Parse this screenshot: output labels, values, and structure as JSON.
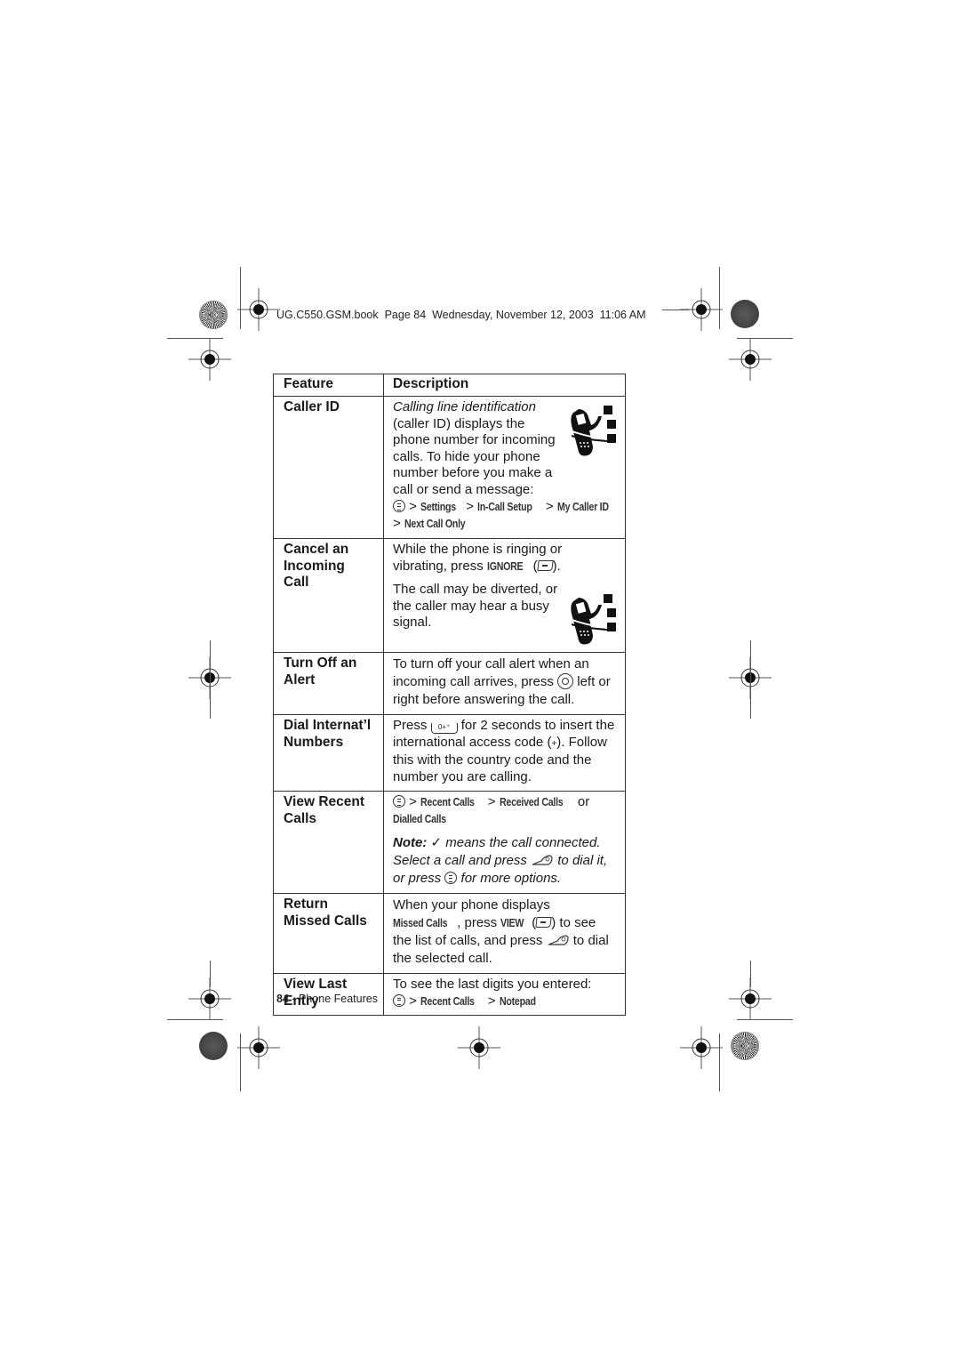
{
  "slug": {
    "text": "UG.C550.GSM.book  Page 84  Wednesday, November 12, 2003  11:06 AM"
  },
  "table": {
    "headers": {
      "feature": "Feature",
      "description": "Description"
    },
    "rows": [
      {
        "feature": "Caller ID",
        "desc_italic": "Calling line identification",
        "desc_text": "(caller ID) displays the phone number for incoming calls. To hide your phone number before you make a call or send a message:",
        "path": [
          "Settings",
          "In-Call Setup",
          "My Caller ID",
          "Next Call Only"
        ],
        "icon": "network-feature-phone-icon"
      },
      {
        "feature": "Cancel an Incoming Call",
        "desc_p1_a": "While the phone is ringing or vibrating, press",
        "desc_p1_key": "IGNORE",
        "desc_p2": "The call may be diverted, or the caller may hear a busy signal.",
        "icon": "network-feature-phone-icon"
      },
      {
        "feature": "Turn Off an Alert",
        "desc_a": "To turn off your call alert when an incoming call arrives, press",
        "desc_b": "left or right before answering the call."
      },
      {
        "feature": "Dial Internat’l Numbers",
        "desc_a": "Press",
        "key_label": "0+⁺",
        "desc_b": "for 2 seconds to insert the international access code (",
        "plus": "+",
        "desc_c": "). Follow this with the country code and the number you are calling."
      },
      {
        "feature": "View Recent Calls",
        "path_a": "Recent Calls",
        "path_b": "Received Calls",
        "or": "or",
        "path_c": "Dialled Calls",
        "note_label": "Note:",
        "note_check": "✓",
        "note_a": "means the call connected. Select a call and press",
        "note_b": "to dial it, or press",
        "note_c": "for more options."
      },
      {
        "feature": "Return Missed Calls",
        "desc_a": "When your phone displays",
        "desc_key1": "Missed Calls",
        "desc_b": ", press",
        "desc_key2": "VIEW",
        "desc_c": ") to see the list of calls, and press",
        "desc_d": "to dial the selected call."
      },
      {
        "feature": "View Last Entry",
        "desc_a": "To see the last digits you entered:",
        "path": [
          "Recent Calls",
          "Notepad"
        ]
      }
    ]
  },
  "footer": {
    "page_number": "84",
    "section": " - Phone Features"
  },
  "separator": ">"
}
